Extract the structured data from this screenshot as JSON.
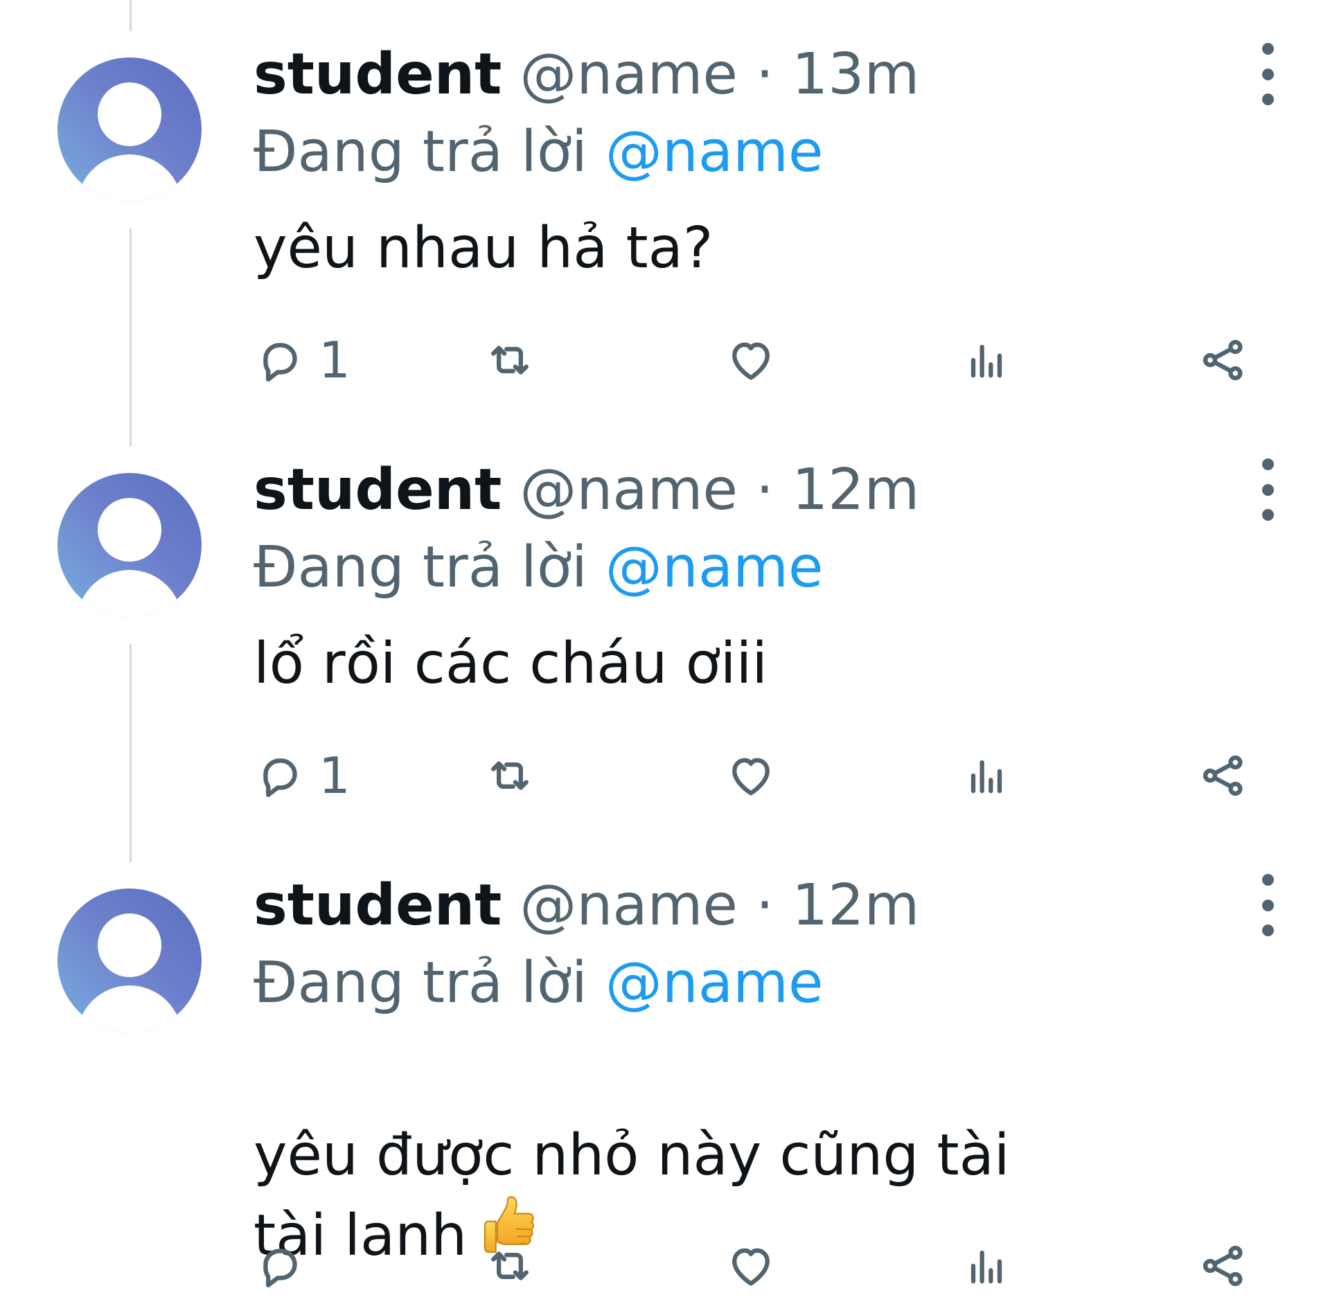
{
  "tweets": [
    {
      "author": "student",
      "handle": "@name",
      "separator": "·",
      "time": "13m",
      "replying_prefix": "Đang trả lời",
      "replying_to": "@name",
      "content": "yêu nhau hả ta?",
      "reply_count": "1"
    },
    {
      "author": "student",
      "handle": "@name",
      "separator": "·",
      "time": "12m",
      "replying_prefix": "Đang trả lời",
      "replying_to": "@name",
      "content": "lổ rồi các cháu ơiii",
      "reply_count": "1"
    },
    {
      "author": "student",
      "handle": "@name",
      "separator": "·",
      "time": "12m",
      "replying_prefix": "Đang trả lời",
      "replying_to": "@name",
      "content": "yêu được nhỏ này cũng tài\ntài lanh",
      "content_emoji": "thumbs-up",
      "reply_count": ""
    }
  ],
  "icons": {
    "reply": "reply-icon",
    "retweet": "retweet-icon",
    "like": "heart-icon",
    "views": "analytics-icon",
    "share": "share-icon",
    "more": "more-vertical-icon"
  },
  "colors": {
    "text": "#0f1419",
    "secondary": "#536471",
    "link": "#1d9bf0",
    "thread_line": "#cfd9de",
    "avatar_gradient": [
      "#5b6fc1",
      "#78aee0"
    ]
  }
}
